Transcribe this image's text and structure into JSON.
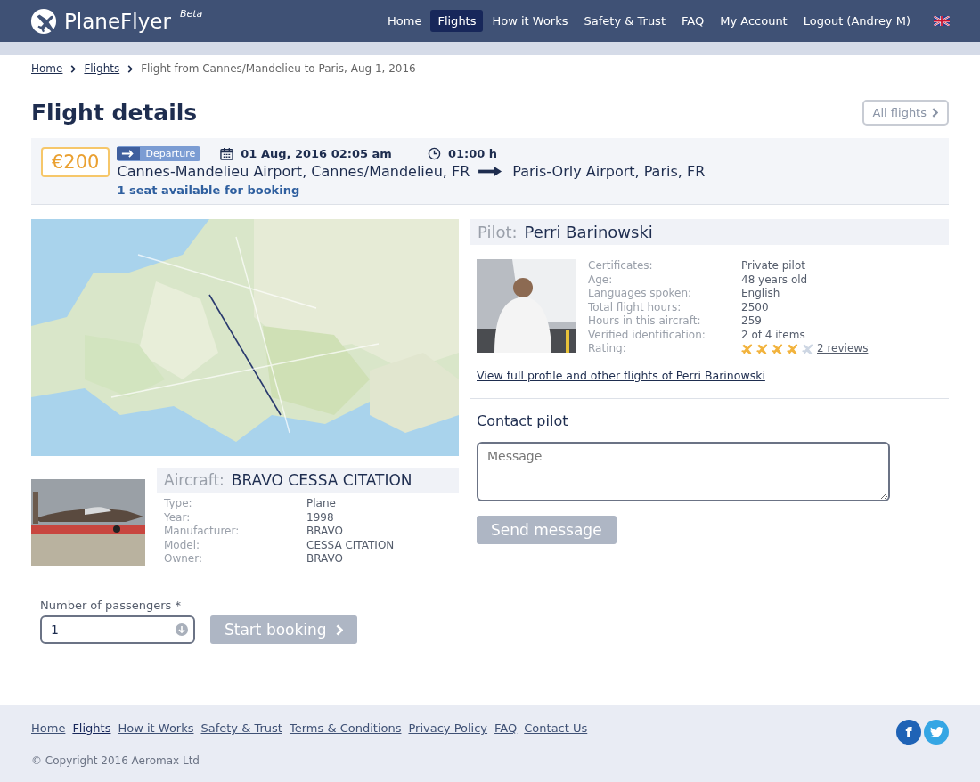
{
  "header": {
    "brand": "PlaneFlyer",
    "badge": "Beta",
    "nav": [
      {
        "label": "Home",
        "selected": false
      },
      {
        "label": "Flights",
        "selected": true
      },
      {
        "label": "How it Works",
        "selected": false
      },
      {
        "label": "Safety & Trust",
        "selected": false
      },
      {
        "label": "FAQ",
        "selected": false
      },
      {
        "label": "My Account",
        "selected": false
      },
      {
        "label": "Logout (Andrey M)",
        "selected": false
      }
    ]
  },
  "breadcrumb": {
    "links": [
      "Home",
      "Flights"
    ],
    "current": "Flight from Cannes/Mandelieu to Paris, Aug 1, 2016"
  },
  "page_title": "Flight details",
  "all_flights_button": "All flights",
  "flight": {
    "price": "€200",
    "direction": "Departure",
    "date": "01 Aug, 2016 02:05 am",
    "duration": "01:00 h",
    "from": "Cannes-Mandelieu Airport, Cannes/Mandelieu, FR",
    "to": "Paris-Orly Airport, Paris, FR",
    "seats": "1 seat available for booking"
  },
  "aircraft": {
    "label": "Aircraft:",
    "name": "BRAVO CESSA CITATION",
    "details": [
      {
        "label": "Type:",
        "value": "Plane"
      },
      {
        "label": "Year:",
        "value": "1998"
      },
      {
        "label": "Manufacturer:",
        "value": "BRAVO"
      },
      {
        "label": "Model:",
        "value": "CESSA CITATION"
      },
      {
        "label": "Owner:",
        "value": "BRAVO"
      }
    ]
  },
  "booking": {
    "label": "Number of passengers *",
    "value": "1",
    "button": "Start booking"
  },
  "pilot": {
    "label": "Pilot:",
    "name": "Perri Barinowski",
    "details": [
      {
        "label": "Certificates:",
        "value": "Private pilot"
      },
      {
        "label": "Age:",
        "value": "48 years old"
      },
      {
        "label": "Languages spoken:",
        "value": "English"
      },
      {
        "label": "Total flight hours:",
        "value": "2500"
      },
      {
        "label": "Hours in this aircraft:",
        "value": "259"
      },
      {
        "label": "Verified identification:",
        "value": "2 of 4 items"
      }
    ],
    "rating_label": "Rating:",
    "stars": 4,
    "reviews": "2 reviews",
    "profile_link": "View full profile and other flights of Perri Barinowski"
  },
  "contact": {
    "title": "Contact pilot",
    "placeholder": "Message",
    "button": "Send message"
  },
  "footer": {
    "links": [
      {
        "label": "Home",
        "selected": false
      },
      {
        "label": "Flights",
        "selected": true
      },
      {
        "label": "How it Works",
        "selected": false
      },
      {
        "label": "Safety & Trust",
        "selected": false
      },
      {
        "label": "Terms & Conditions",
        "selected": false
      },
      {
        "label": "Privacy Policy",
        "selected": false
      },
      {
        "label": "FAQ",
        "selected": false
      },
      {
        "label": "Contact Us",
        "selected": false
      }
    ],
    "social": [
      {
        "kind": "facebook",
        "glyph": "f"
      },
      {
        "kind": "twitter"
      }
    ],
    "copyright": "© Copyright 2016 Aeromax Ltd"
  }
}
